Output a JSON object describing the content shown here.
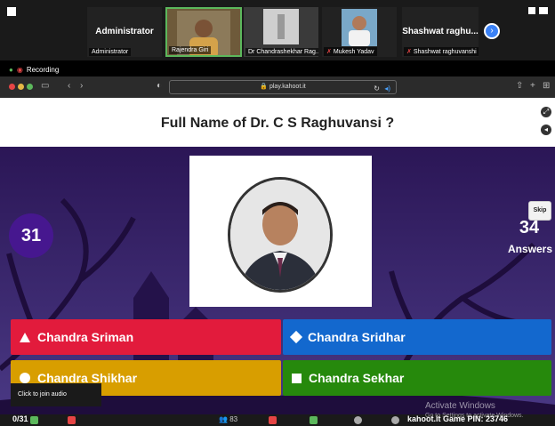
{
  "zoom": {
    "tiles": [
      {
        "big_name": "Administrator",
        "tag": "Administrator"
      },
      {
        "big_name": "",
        "tag": "Rajendra Giri"
      },
      {
        "big_name": "",
        "tag": "Dr Chandrashekhar Rag..."
      },
      {
        "big_name": "",
        "tag": "Mukesh Yadav"
      },
      {
        "big_name": "Shashwat raghu...",
        "tag": "Shashwat raghuvanshi"
      }
    ],
    "recording_label": "Recording",
    "next_icon": "chevron-right-icon"
  },
  "browser": {
    "url": "play.kahoot.it"
  },
  "quiz": {
    "question": "Full Name of Dr. C S Raghuvansi ?",
    "timer": "31",
    "answers_count": "34",
    "answers_label": "Answers",
    "skip_label": "Skip",
    "answers": [
      {
        "label": "Chandra Sriman",
        "color": "#e21b3c",
        "shape": "triangle"
      },
      {
        "label": "Chandra Sridhar",
        "color": "#1368ce",
        "shape": "diamond"
      },
      {
        "label": "Chandra Shikhar",
        "color": "#d89e00",
        "shape": "circle"
      },
      {
        "label": "Chandra Sekhar",
        "color": "#26890c",
        "shape": "square"
      }
    ]
  },
  "overlay": {
    "tooltip": "Click to join audio",
    "watermark_title": "Activate Windows",
    "watermark_sub": "Go to Settings to activate Windows.",
    "bottom_count": "0/31",
    "bottom_pin": "kahoot.it Game PIN: 23746",
    "participants": "83"
  }
}
